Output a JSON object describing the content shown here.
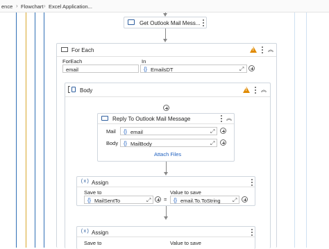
{
  "breadcrumb": {
    "items": [
      "ence",
      "Flowchart",
      "Excel Application..."
    ]
  },
  "outlook_get": {
    "title": "Get Outlook Mail Mess..."
  },
  "for_each": {
    "title": "For Each",
    "foreach_label": "ForEach",
    "in_label": "In",
    "item_value": "email",
    "in_value": "EmailsDT"
  },
  "body_seq": {
    "title": "Body"
  },
  "reply": {
    "title": "Reply To Outlook Mail Message",
    "mail_label": "Mail",
    "mail_value": "email",
    "body_label": "Body",
    "body_value": "MailBody",
    "attach_link": "Attach Files"
  },
  "assign1": {
    "title": "Assign",
    "save_to_label": "Save to",
    "value_label": "Value to save",
    "save_to_value": "MailSentTo",
    "value_value": "email.To.ToString",
    "equals": "="
  },
  "assign2": {
    "title": "Assign",
    "save_to_label": "Save to",
    "value_label": "Value to save"
  },
  "colors": {
    "accent_blue": "#1e5fbf",
    "warning": "#e08a00",
    "line_blue": "#2f6fb5",
    "line_gold": "#d9a62b"
  }
}
